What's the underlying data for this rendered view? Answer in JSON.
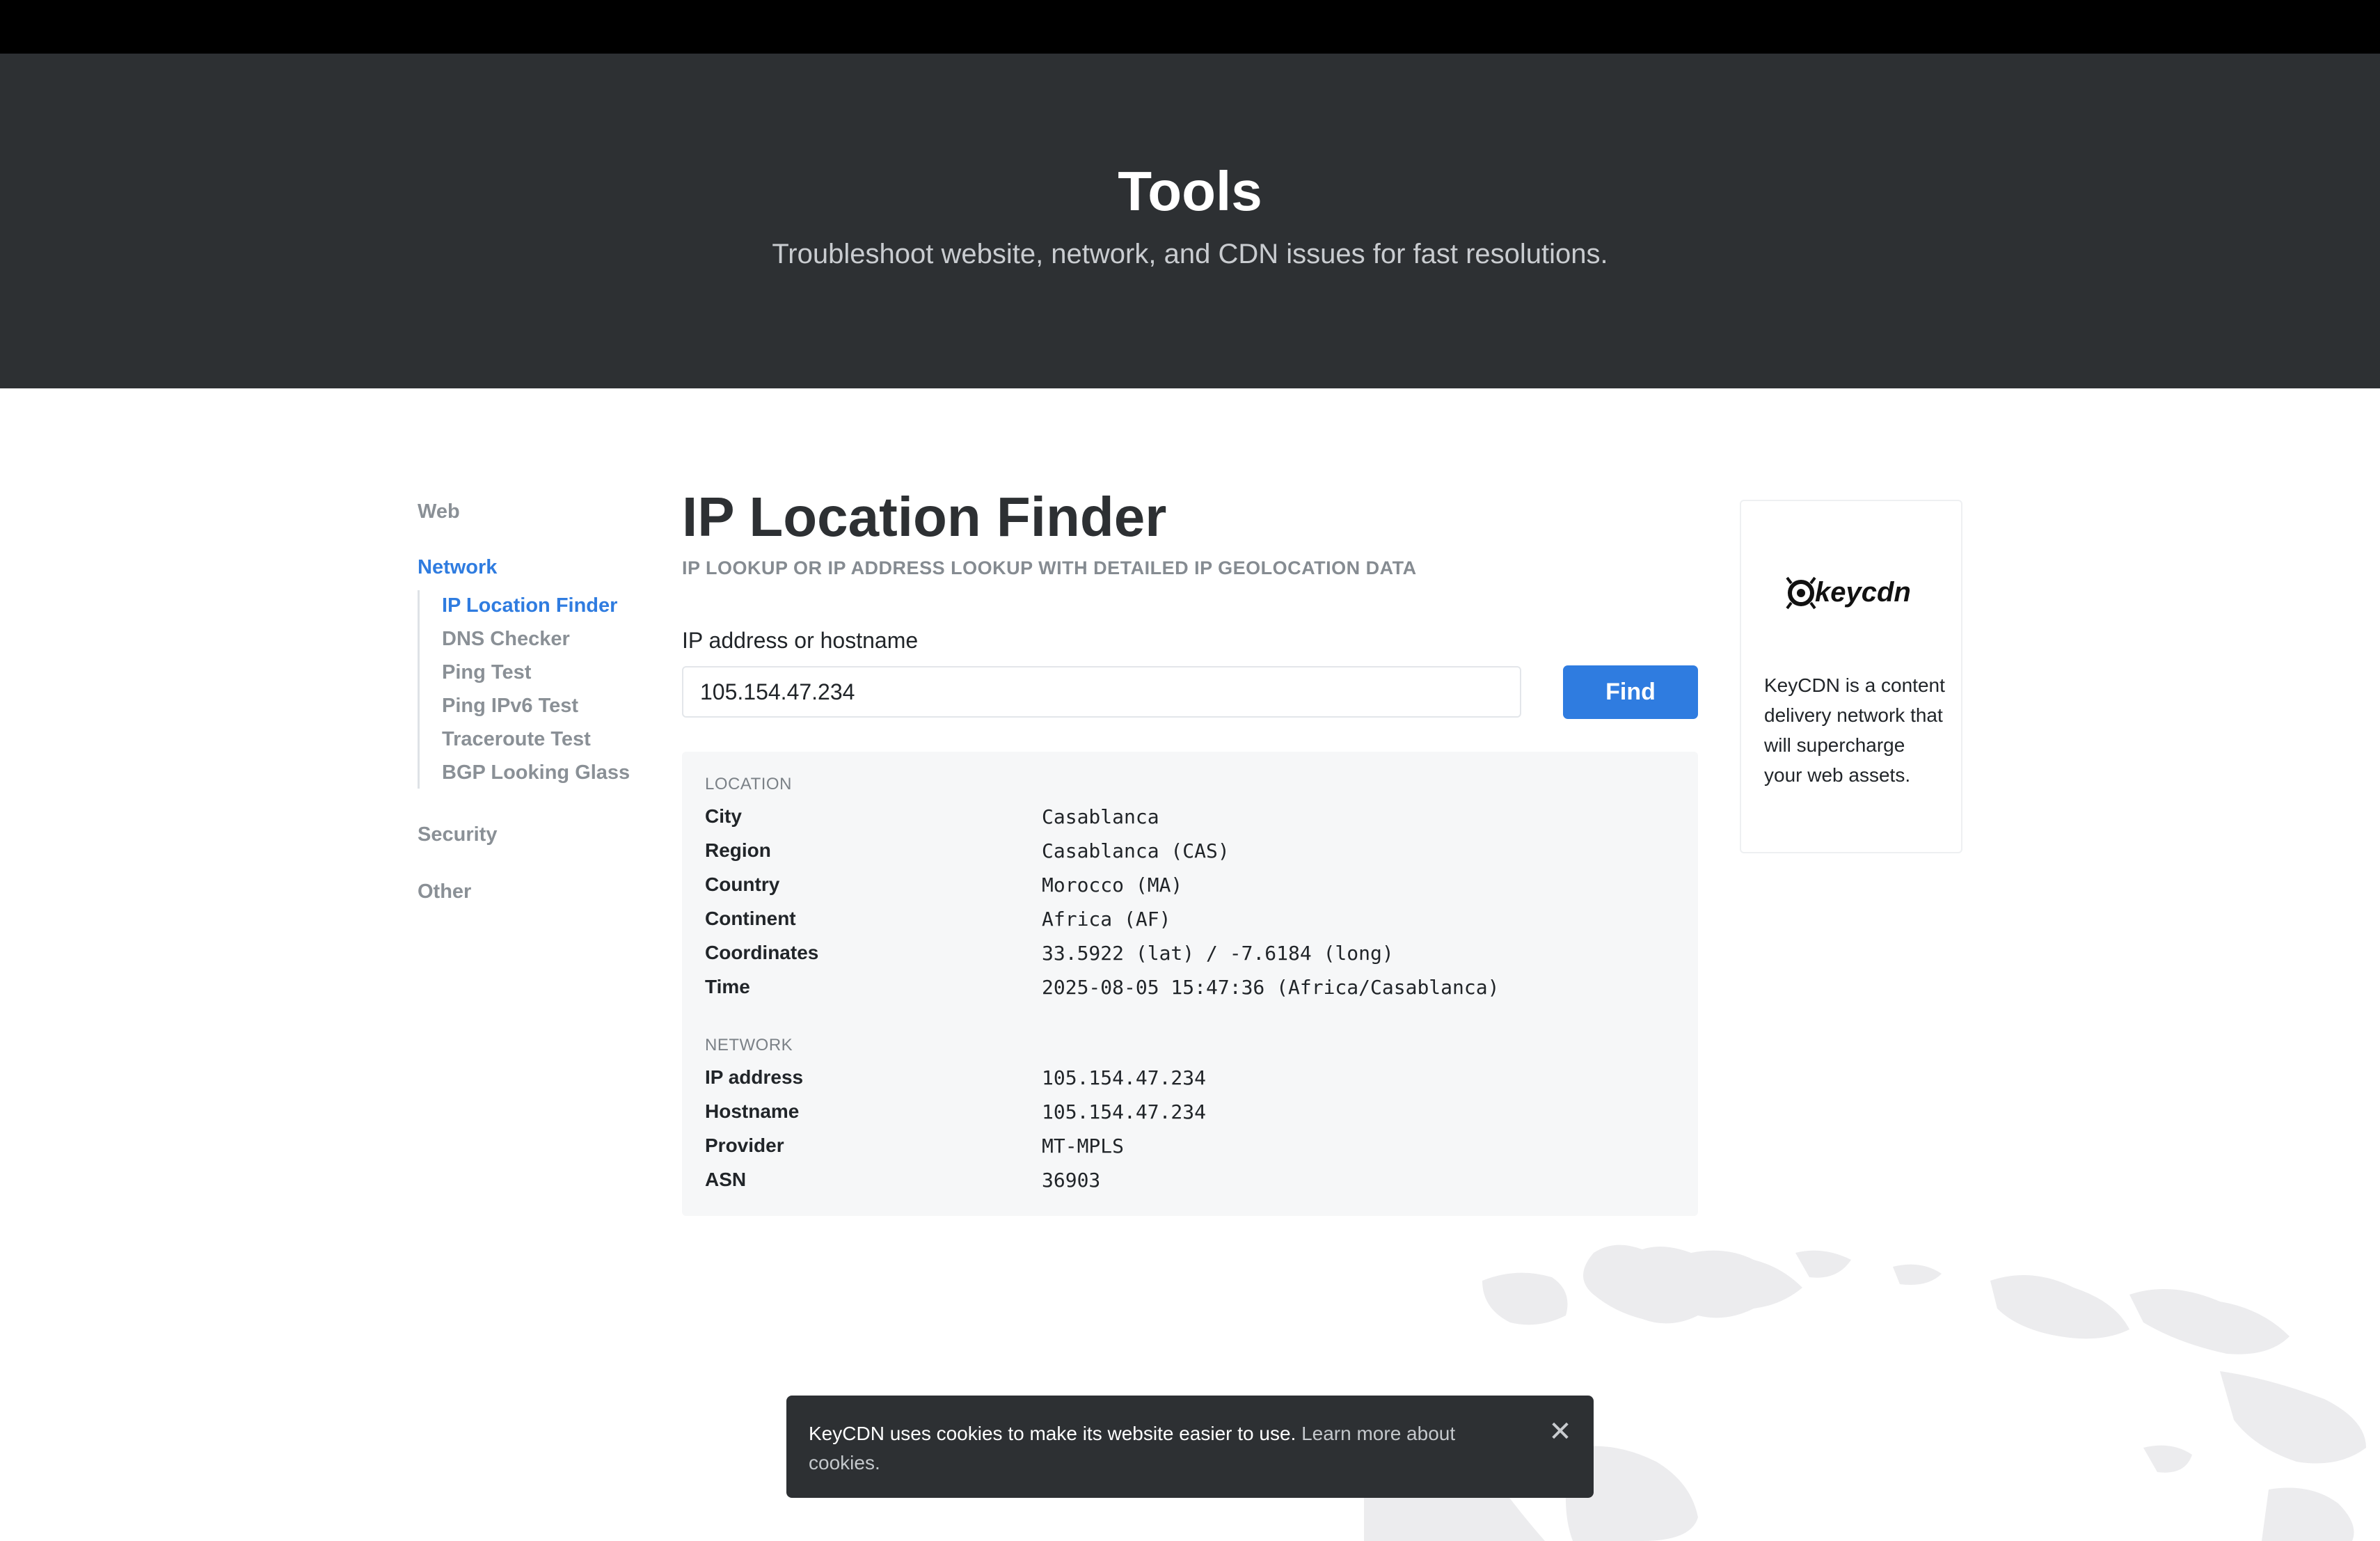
{
  "hero": {
    "title": "Tools",
    "subtitle": "Troubleshoot website, network, and CDN issues for fast resolutions."
  },
  "sidebar": {
    "sections": [
      {
        "label": "Web",
        "active": false
      },
      {
        "label": "Network",
        "active": true
      },
      {
        "label": "Security",
        "active": false
      },
      {
        "label": "Other",
        "active": false
      }
    ],
    "network_items": [
      {
        "label": "IP Location Finder",
        "active": true
      },
      {
        "label": "DNS Checker",
        "active": false
      },
      {
        "label": "Ping Test",
        "active": false
      },
      {
        "label": "Ping IPv6 Test",
        "active": false
      },
      {
        "label": "Traceroute Test",
        "active": false
      },
      {
        "label": "BGP Looking Glass",
        "active": false
      }
    ]
  },
  "main": {
    "title": "IP Location Finder",
    "subtitle": "IP LOOKUP OR IP ADDRESS LOOKUP WITH DETAILED IP GEOLOCATION DATA",
    "field_label": "IP address or hostname",
    "input_value": "105.154.47.234",
    "find_label": "Find"
  },
  "results": {
    "location": {
      "heading": "LOCATION",
      "rows": [
        {
          "label": "City",
          "value": "Casablanca"
        },
        {
          "label": "Region",
          "value": "Casablanca (CAS)"
        },
        {
          "label": "Country",
          "value": "Morocco (MA)"
        },
        {
          "label": "Continent",
          "value": "Africa (AF)"
        },
        {
          "label": "Coordinates",
          "value": "33.5922 (lat) / -7.6184 (long)"
        },
        {
          "label": "Time",
          "value": "2025-08-05 15:47:36 (Africa/Casablanca)"
        }
      ]
    },
    "network": {
      "heading": "NETWORK",
      "rows": [
        {
          "label": "IP address",
          "value": "105.154.47.234"
        },
        {
          "label": "Hostname",
          "value": "105.154.47.234"
        },
        {
          "label": "Provider",
          "value": "MT-MPLS"
        },
        {
          "label": "ASN",
          "value": "36903"
        }
      ]
    }
  },
  "ad": {
    "logo_text": "keycdn",
    "text": "KeyCDN is a content delivery network that will supercharge your web assets."
  },
  "cookie": {
    "text": "KeyCDN uses cookies to make its website easier to use.",
    "link": "Learn more about cookies.",
    "close_icon": "close-icon"
  },
  "colors": {
    "accent": "#2f7ce0",
    "hero_bg": "#2d3033",
    "topbar": "#000000",
    "results_bg": "#f6f7f8"
  }
}
